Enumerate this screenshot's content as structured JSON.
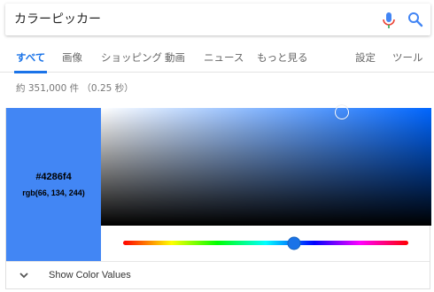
{
  "search": {
    "query": "カラーピッカー"
  },
  "tabs": [
    {
      "label": "すべて",
      "active": true
    },
    {
      "label": "画像"
    },
    {
      "label": "ショッピング"
    },
    {
      "label": "動画"
    },
    {
      "label": "ニュース"
    },
    {
      "label": "もっと見る"
    },
    {
      "label": "設定"
    },
    {
      "label": "ツール"
    }
  ],
  "stats": "約 351,000 件 （0.25 秒）",
  "color_picker": {
    "hex": "#4286f4",
    "rgb": "rgb(66, 134, 244)",
    "hue_fraction": 0.6,
    "saturation": 0.73,
    "brightness": 0.96,
    "footer_label": "Show Color Values"
  },
  "colors": {
    "accent": "#1a73e8",
    "swatch": "#4286f4"
  }
}
